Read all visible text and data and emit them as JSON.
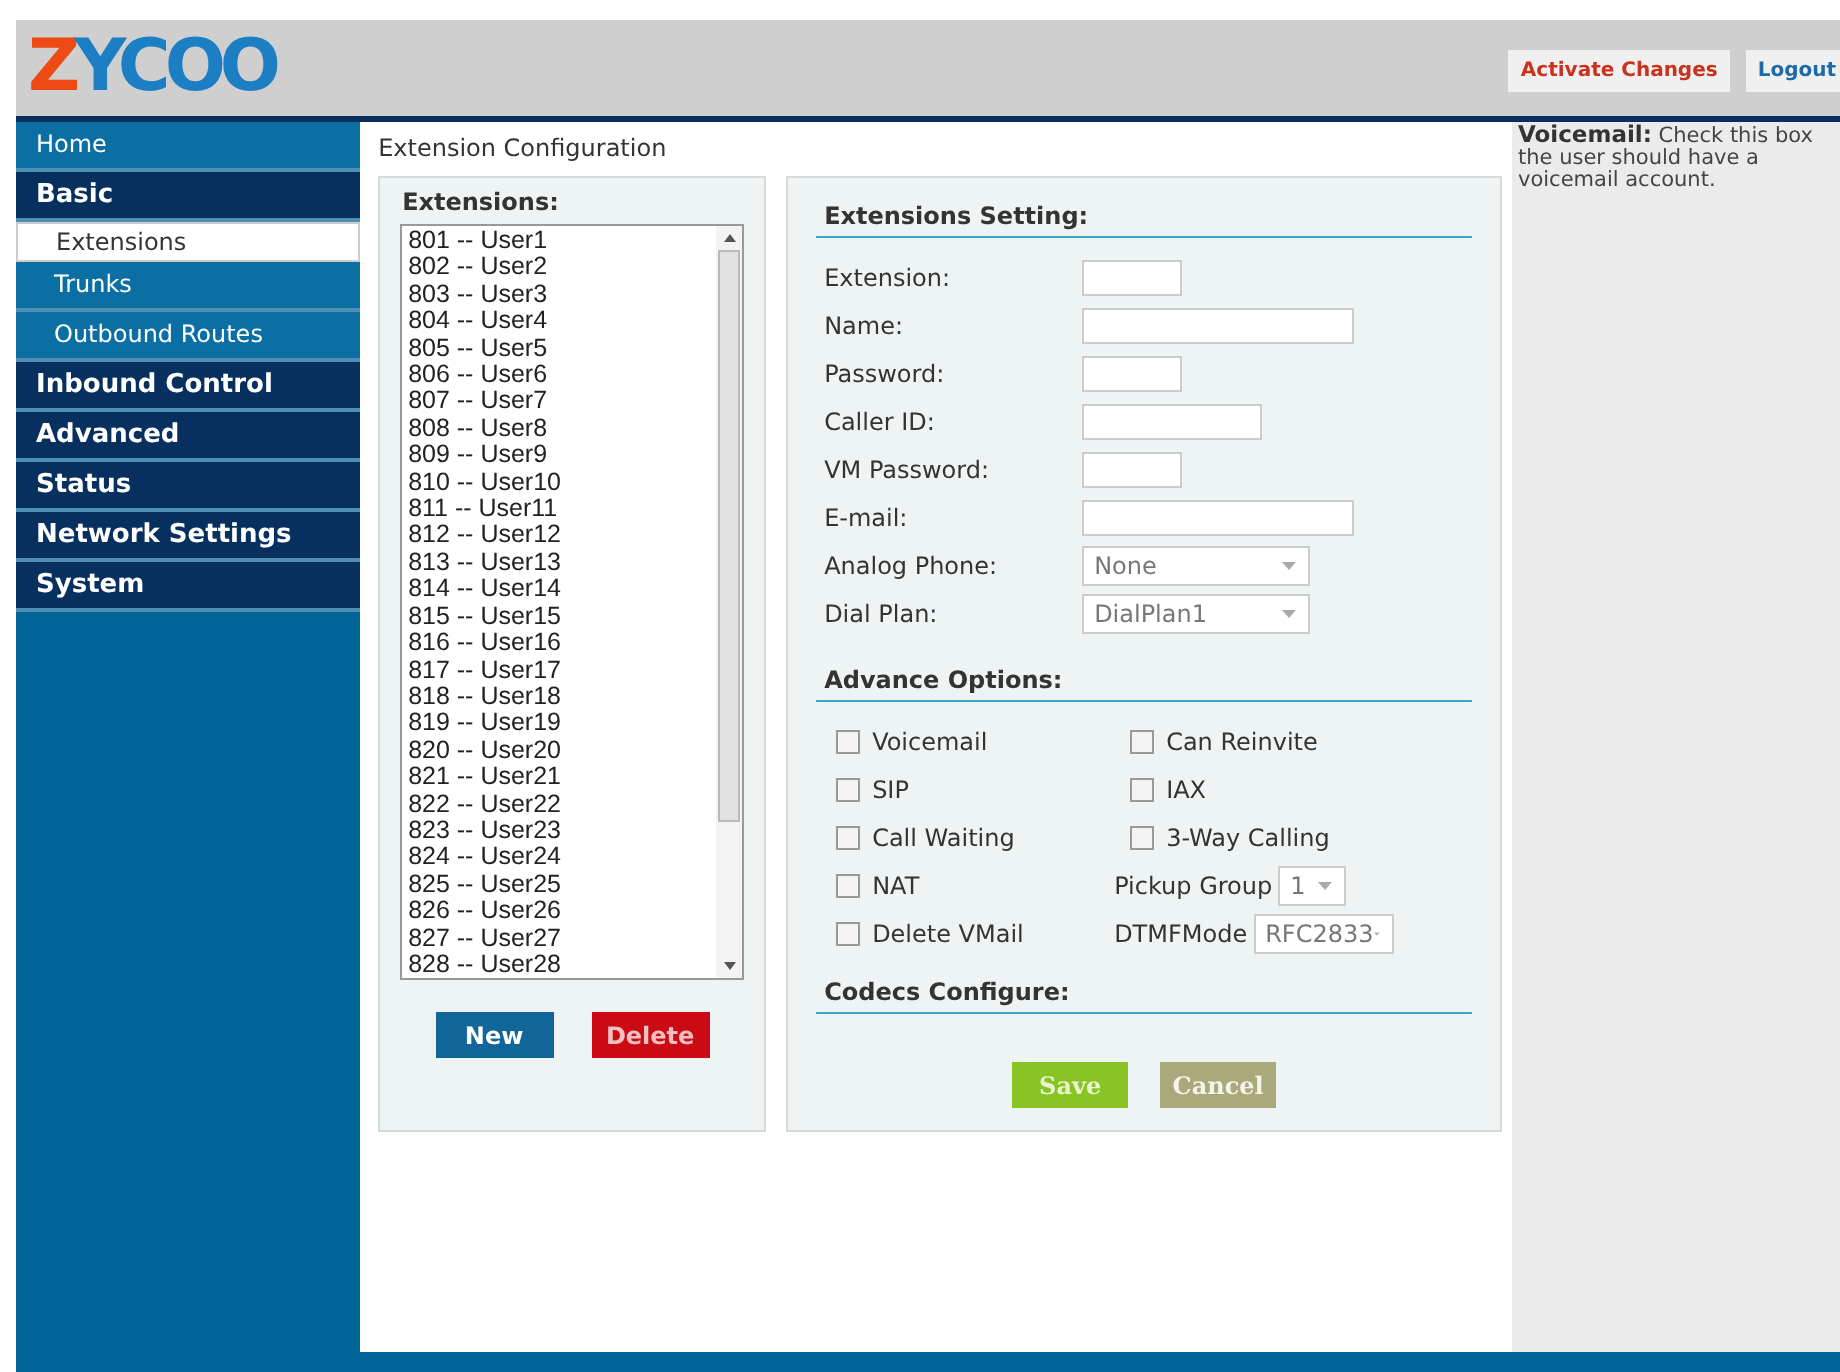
{
  "logo": "ZYCOO",
  "header_buttons": [
    {
      "label": "Activate Changes",
      "kind": "activate"
    },
    {
      "label": "Logout",
      "kind": "logout"
    }
  ],
  "sidebar": {
    "items": [
      {
        "label": "Home",
        "kind": "link",
        "selected": false
      },
      {
        "label": "Basic",
        "kind": "section",
        "selected": false
      },
      {
        "label": "Extensions",
        "kind": "sub",
        "selected": true
      },
      {
        "label": "Trunks",
        "kind": "sub",
        "selected": false
      },
      {
        "label": "Outbound Routes",
        "kind": "sub",
        "selected": false
      },
      {
        "label": "Inbound Control",
        "kind": "section",
        "selected": false
      },
      {
        "label": "Advanced",
        "kind": "section",
        "selected": false
      },
      {
        "label": "Status",
        "kind": "section",
        "selected": false
      },
      {
        "label": "Network Settings",
        "kind": "section",
        "selected": false
      },
      {
        "label": "System",
        "kind": "section",
        "selected": false
      }
    ]
  },
  "page_title": "Extension Configuration",
  "extensions": {
    "title": "Extensions:",
    "items": [
      "801 -- User1",
      "802 -- User2",
      "803 -- User3",
      "804 -- User4",
      "805 -- User5",
      "806 -- User6",
      "807 -- User7",
      "808 -- User8",
      "809 -- User9",
      "810 -- User10",
      "811 -- User11",
      "812 -- User12",
      "813 -- User13",
      "814 -- User14",
      "815 -- User15",
      "816 -- User16",
      "817 -- User17",
      "818 -- User18",
      "819 -- User19",
      "820 -- User20",
      "821 -- User21",
      "822 -- User22",
      "823 -- User23",
      "824 -- User24",
      "825 -- User25",
      "826 -- User26",
      "827 -- User27",
      "828 -- User28"
    ],
    "buttons": [
      {
        "label": "New",
        "kind": "primary"
      },
      {
        "label": "Delete",
        "kind": "danger"
      }
    ]
  },
  "settings": {
    "title": "Extensions Setting:",
    "fields": [
      {
        "label": "Extension:",
        "kind": "text"
      },
      {
        "label": "Name:",
        "kind": "text"
      },
      {
        "label": "Password:",
        "kind": "text"
      },
      {
        "label": "Caller ID:",
        "kind": "text"
      },
      {
        "label": "VM Password:",
        "kind": "text"
      },
      {
        "label": "E-mail:",
        "kind": "text"
      },
      {
        "label": "Analog Phone:",
        "kind": "select",
        "value": "None"
      },
      {
        "label": "Dial Plan:",
        "kind": "select",
        "value": "DialPlan1"
      }
    ]
  },
  "advance": {
    "title": "Advance Options:",
    "options": [
      {
        "kind": "checkbox",
        "label": "Voicemail",
        "checked": false
      },
      {
        "kind": "checkbox",
        "label": "Can Reinvite",
        "checked": false
      },
      {
        "kind": "checkbox",
        "label": "SIP",
        "checked": false
      },
      {
        "kind": "checkbox",
        "label": "IAX",
        "checked": false
      },
      {
        "kind": "checkbox",
        "label": "Call Waiting",
        "checked": false
      },
      {
        "kind": "checkbox",
        "label": "3-Way Calling",
        "checked": false
      },
      {
        "kind": "checkbox",
        "label": "NAT",
        "checked": false
      },
      {
        "kind": "select",
        "label": "Pickup Group",
        "value": "1"
      },
      {
        "kind": "checkbox",
        "label": "Delete VMail",
        "checked": false
      },
      {
        "kind": "select",
        "label": "DTMFMode",
        "value": "RFC2833"
      }
    ]
  },
  "codecs": {
    "title": "Codecs Configure:"
  },
  "form_buttons": [
    {
      "label": "Save",
      "kind": "save",
      "disabled": false
    },
    {
      "label": "Cancel",
      "kind": "cancel",
      "disabled": true
    }
  ],
  "help": "**Voicemail:** Check this box the user should have a voicemail account."
}
